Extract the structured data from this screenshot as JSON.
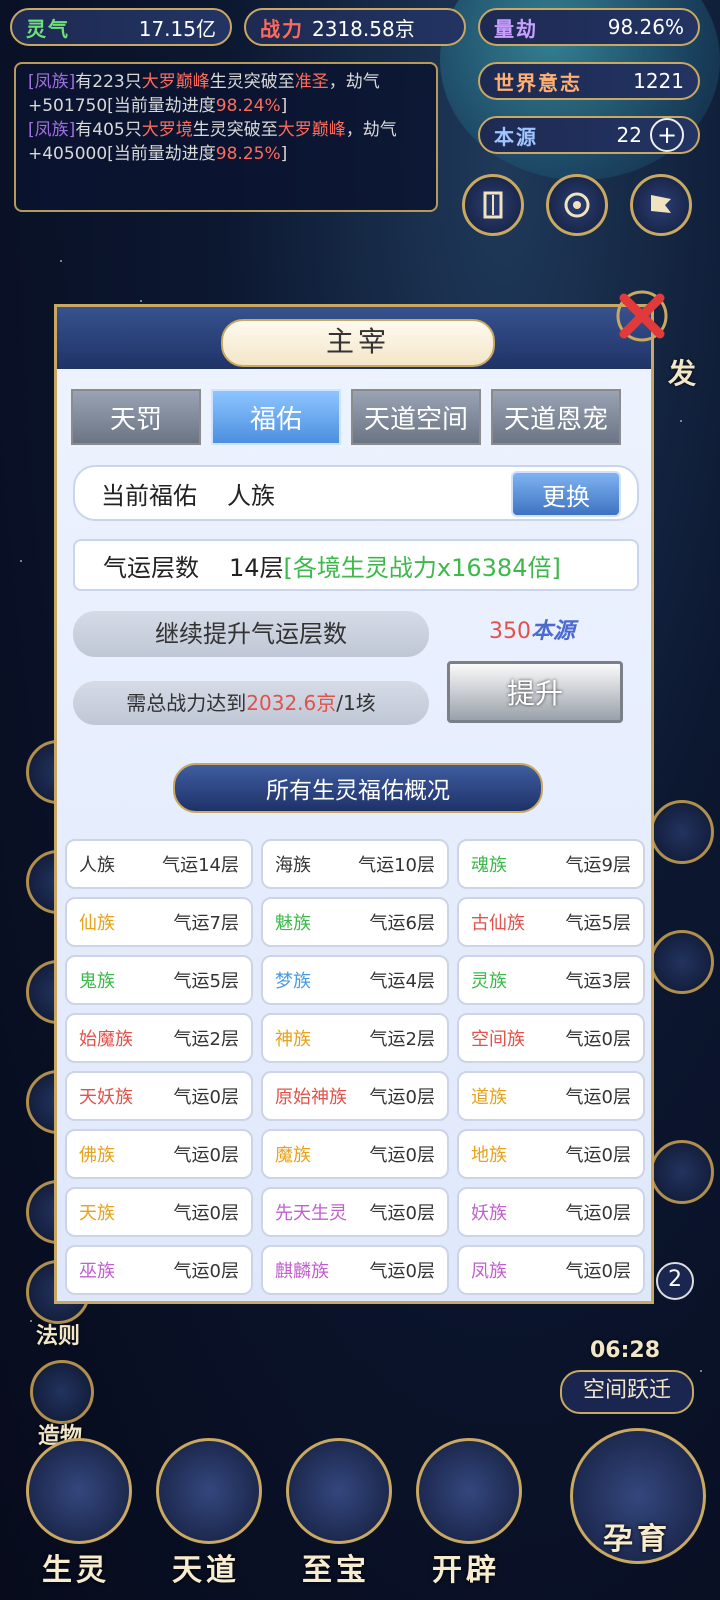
{
  "top_stats": {
    "lingqi": {
      "label": "灵气",
      "value": "17.15亿"
    },
    "zhanli": {
      "label": "战力",
      "value": "2318.58京"
    },
    "liangjie": {
      "label": "量劫",
      "value": "98.26%"
    },
    "shijie": {
      "label": "世界意志",
      "value": "1221"
    },
    "benyuan": {
      "label": "本源",
      "value": "22"
    }
  },
  "log": {
    "entry1": {
      "faction": "[凤族]",
      "t1": "有223只",
      "realm": "大罗巅峰",
      "t2": "生灵突破至",
      "target": "准圣",
      "t3": "，劫气+501750[当前量劫进度",
      "progress": "98.24%",
      "t4": "]"
    },
    "entry2": {
      "faction": "[凤族]",
      "t1": "有405只",
      "realm": "大罗境",
      "t2": "生灵突破至",
      "target": "大罗巅峰",
      "t3": "，劫气+405000[当前量劫进度",
      "progress": "98.25%",
      "t4": "]"
    }
  },
  "side": {
    "fa_ze": "法则",
    "zao_wu": "造物",
    "kong_jian": "空间跃迁",
    "timer": "06:28",
    "badge": "2",
    "fa": "发"
  },
  "bottom_nav": [
    "生灵",
    "天道",
    "至宝",
    "开辟",
    "孕育"
  ],
  "modal": {
    "title": "主宰",
    "tabs": [
      "天罚",
      "福佑",
      "天道空间",
      "天道恩宠"
    ],
    "current_label": "当前福佑",
    "current_value": "人族",
    "change_btn": "更换",
    "luck_label": "气运层数",
    "luck_value": "14层",
    "luck_bonus": "[各境生灵战力x16384倍]",
    "upgrade_label": "继续提升气运层数",
    "cost_num": "350",
    "cost_unit": "本源",
    "req_prefix": "需总战力达到",
    "req_value": "2032.6京",
    "req_suffix": "/1垓",
    "upgrade_btn": "提升",
    "overview_title": "所有生灵福佑概况"
  },
  "races": [
    {
      "name": "人族",
      "luck": "气运14层",
      "color": "#333333"
    },
    {
      "name": "海族",
      "luck": "气运10层",
      "color": "#333333"
    },
    {
      "name": "魂族",
      "luck": "气运9层",
      "color": "#3cb94a"
    },
    {
      "name": "仙族",
      "luck": "气运7层",
      "color": "#e8a21a"
    },
    {
      "name": "魅族",
      "luck": "气运6层",
      "color": "#3cb94a"
    },
    {
      "name": "古仙族",
      "luck": "气运5层",
      "color": "#e0524b"
    },
    {
      "name": "鬼族",
      "luck": "气运5层",
      "color": "#3cb94a"
    },
    {
      "name": "梦族",
      "luck": "气运4层",
      "color": "#4a9ae0"
    },
    {
      "name": "灵族",
      "luck": "气运3层",
      "color": "#3cb94a"
    },
    {
      "name": "始魔族",
      "luck": "气运2层",
      "color": "#e0524b"
    },
    {
      "name": "神族",
      "luck": "气运2层",
      "color": "#e8a21a"
    },
    {
      "name": "空间族",
      "luck": "气运0层",
      "color": "#e0524b"
    },
    {
      "name": "天妖族",
      "luck": "气运0层",
      "color": "#e0524b"
    },
    {
      "name": "原始神族",
      "luck": "气运0层",
      "color": "#e0524b"
    },
    {
      "name": "道族",
      "luck": "气运0层",
      "color": "#e8a21a"
    },
    {
      "name": "佛族",
      "luck": "气运0层",
      "color": "#e8a21a"
    },
    {
      "name": "魔族",
      "luck": "气运0层",
      "color": "#e8a21a"
    },
    {
      "name": "地族",
      "luck": "气运0层",
      "color": "#e8a21a"
    },
    {
      "name": "天族",
      "luck": "气运0层",
      "color": "#e8a21a"
    },
    {
      "name": "先天生灵",
      "luck": "气运0层",
      "color": "#c25fd0"
    },
    {
      "name": "妖族",
      "luck": "气运0层",
      "color": "#c25fd0"
    },
    {
      "name": "巫族",
      "luck": "气运0层",
      "color": "#c25fd0"
    },
    {
      "name": "麒麟族",
      "luck": "气运0层",
      "color": "#c25fd0"
    },
    {
      "name": "凤族",
      "luck": "气运0层",
      "color": "#c25fd0"
    }
  ],
  "colors": {
    "faction": "#a070e0",
    "realm": "#ff6a5a",
    "progress": "#ff6a5a",
    "bonus": "#3cb94a",
    "cost_num": "#e0524b",
    "cost_unit": "#4a6ad0"
  }
}
